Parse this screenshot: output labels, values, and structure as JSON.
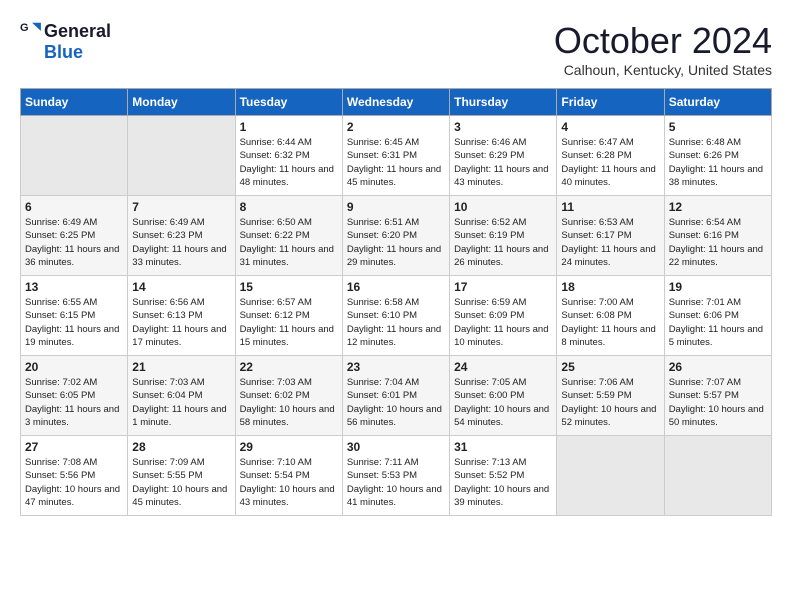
{
  "header": {
    "logo_general": "General",
    "logo_blue": "Blue",
    "month": "October 2024",
    "location": "Calhoun, Kentucky, United States"
  },
  "days_of_week": [
    "Sunday",
    "Monday",
    "Tuesday",
    "Wednesday",
    "Thursday",
    "Friday",
    "Saturday"
  ],
  "weeks": [
    [
      {
        "day": "",
        "empty": true
      },
      {
        "day": "",
        "empty": true
      },
      {
        "day": "1",
        "sunrise": "6:44 AM",
        "sunset": "6:32 PM",
        "daylight": "11 hours and 48 minutes."
      },
      {
        "day": "2",
        "sunrise": "6:45 AM",
        "sunset": "6:31 PM",
        "daylight": "11 hours and 45 minutes."
      },
      {
        "day": "3",
        "sunrise": "6:46 AM",
        "sunset": "6:29 PM",
        "daylight": "11 hours and 43 minutes."
      },
      {
        "day": "4",
        "sunrise": "6:47 AM",
        "sunset": "6:28 PM",
        "daylight": "11 hours and 40 minutes."
      },
      {
        "day": "5",
        "sunrise": "6:48 AM",
        "sunset": "6:26 PM",
        "daylight": "11 hours and 38 minutes."
      }
    ],
    [
      {
        "day": "6",
        "sunrise": "6:49 AM",
        "sunset": "6:25 PM",
        "daylight": "11 hours and 36 minutes."
      },
      {
        "day": "7",
        "sunrise": "6:49 AM",
        "sunset": "6:23 PM",
        "daylight": "11 hours and 33 minutes."
      },
      {
        "day": "8",
        "sunrise": "6:50 AM",
        "sunset": "6:22 PM",
        "daylight": "11 hours and 31 minutes."
      },
      {
        "day": "9",
        "sunrise": "6:51 AM",
        "sunset": "6:20 PM",
        "daylight": "11 hours and 29 minutes."
      },
      {
        "day": "10",
        "sunrise": "6:52 AM",
        "sunset": "6:19 PM",
        "daylight": "11 hours and 26 minutes."
      },
      {
        "day": "11",
        "sunrise": "6:53 AM",
        "sunset": "6:17 PM",
        "daylight": "11 hours and 24 minutes."
      },
      {
        "day": "12",
        "sunrise": "6:54 AM",
        "sunset": "6:16 PM",
        "daylight": "11 hours and 22 minutes."
      }
    ],
    [
      {
        "day": "13",
        "sunrise": "6:55 AM",
        "sunset": "6:15 PM",
        "daylight": "11 hours and 19 minutes."
      },
      {
        "day": "14",
        "sunrise": "6:56 AM",
        "sunset": "6:13 PM",
        "daylight": "11 hours and 17 minutes."
      },
      {
        "day": "15",
        "sunrise": "6:57 AM",
        "sunset": "6:12 PM",
        "daylight": "11 hours and 15 minutes."
      },
      {
        "day": "16",
        "sunrise": "6:58 AM",
        "sunset": "6:10 PM",
        "daylight": "11 hours and 12 minutes."
      },
      {
        "day": "17",
        "sunrise": "6:59 AM",
        "sunset": "6:09 PM",
        "daylight": "11 hours and 10 minutes."
      },
      {
        "day": "18",
        "sunrise": "7:00 AM",
        "sunset": "6:08 PM",
        "daylight": "11 hours and 8 minutes."
      },
      {
        "day": "19",
        "sunrise": "7:01 AM",
        "sunset": "6:06 PM",
        "daylight": "11 hours and 5 minutes."
      }
    ],
    [
      {
        "day": "20",
        "sunrise": "7:02 AM",
        "sunset": "6:05 PM",
        "daylight": "11 hours and 3 minutes."
      },
      {
        "day": "21",
        "sunrise": "7:03 AM",
        "sunset": "6:04 PM",
        "daylight": "11 hours and 1 minute."
      },
      {
        "day": "22",
        "sunrise": "7:03 AM",
        "sunset": "6:02 PM",
        "daylight": "10 hours and 58 minutes."
      },
      {
        "day": "23",
        "sunrise": "7:04 AM",
        "sunset": "6:01 PM",
        "daylight": "10 hours and 56 minutes."
      },
      {
        "day": "24",
        "sunrise": "7:05 AM",
        "sunset": "6:00 PM",
        "daylight": "10 hours and 54 minutes."
      },
      {
        "day": "25",
        "sunrise": "7:06 AM",
        "sunset": "5:59 PM",
        "daylight": "10 hours and 52 minutes."
      },
      {
        "day": "26",
        "sunrise": "7:07 AM",
        "sunset": "5:57 PM",
        "daylight": "10 hours and 50 minutes."
      }
    ],
    [
      {
        "day": "27",
        "sunrise": "7:08 AM",
        "sunset": "5:56 PM",
        "daylight": "10 hours and 47 minutes."
      },
      {
        "day": "28",
        "sunrise": "7:09 AM",
        "sunset": "5:55 PM",
        "daylight": "10 hours and 45 minutes."
      },
      {
        "day": "29",
        "sunrise": "7:10 AM",
        "sunset": "5:54 PM",
        "daylight": "10 hours and 43 minutes."
      },
      {
        "day": "30",
        "sunrise": "7:11 AM",
        "sunset": "5:53 PM",
        "daylight": "10 hours and 41 minutes."
      },
      {
        "day": "31",
        "sunrise": "7:13 AM",
        "sunset": "5:52 PM",
        "daylight": "10 hours and 39 minutes."
      },
      {
        "day": "",
        "empty": true
      },
      {
        "day": "",
        "empty": true
      }
    ]
  ]
}
